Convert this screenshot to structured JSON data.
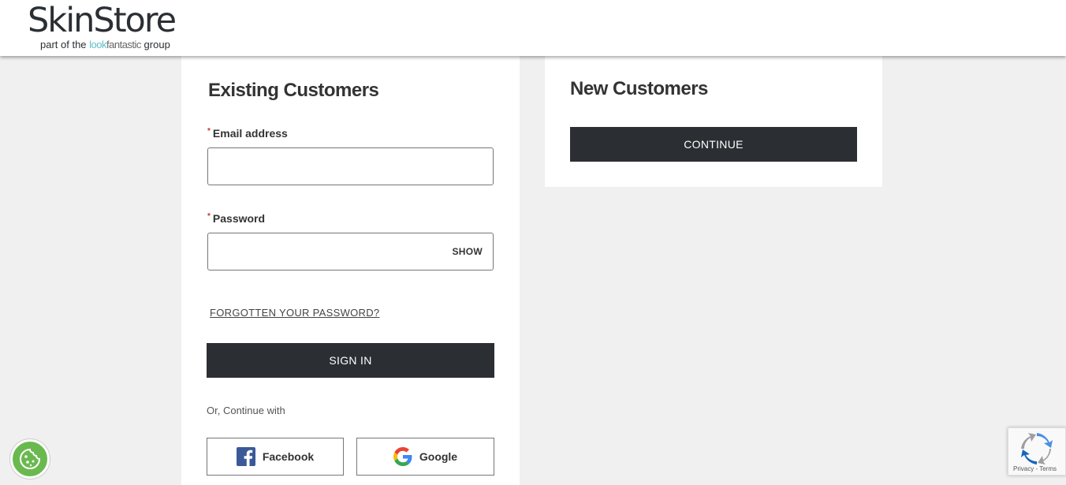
{
  "header": {
    "logo_main": "SkinStore",
    "logo_sub_prefix": "part of the ",
    "logo_brand_a": "look",
    "logo_brand_b": "fantastic",
    "logo_sub_suffix": " group"
  },
  "existing": {
    "heading": "Existing Customers",
    "required_mark": "*",
    "email_label": "Email address",
    "email_value": "",
    "password_label": "Password",
    "password_value": "",
    "show_label": "SHOW",
    "forgot_label": "FORGOTTEN YOUR PASSWORD?",
    "signin_label": "SIGN IN",
    "or_text": "Or, Continue with",
    "facebook_label": "Facebook",
    "google_label": "Google"
  },
  "new_customers": {
    "heading": "New Customers",
    "continue_label": "CONTINUE"
  },
  "recaptcha": {
    "privacy": "Privacy",
    "separator": " - ",
    "terms": "Terms"
  },
  "colors": {
    "button_dark": "#2b2f33",
    "cookie_green": "#6ab94f",
    "brand_teal": "#5bc2c8",
    "facebook_blue": "#3b5998"
  },
  "icons": {
    "cookie": "cookie-icon",
    "facebook": "facebook-icon",
    "google": "google-icon",
    "recaptcha": "recaptcha-icon"
  }
}
